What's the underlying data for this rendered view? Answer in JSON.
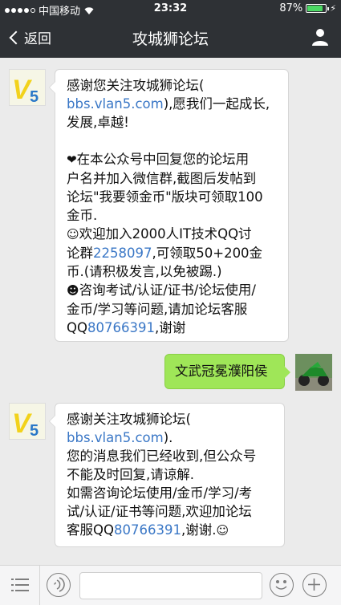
{
  "status_bar": {
    "carrier": "中国移动",
    "time": "23:32",
    "battery": "87%",
    "battery_level": 0.87
  },
  "nav": {
    "back_label": "返回",
    "title": "攻城狮论坛"
  },
  "messages": {
    "m1": {
      "l1": "感谢您关注攻城狮论坛(",
      "l2_link": "bbs.vlan5.com",
      "l2_text": "),愿我们一起成长,",
      "l3": "发展,卓越!",
      "l4": "在本公众号中回复您的论坛用",
      "l5": "户名并加入微信群,截图后发帖到",
      "l6": "论坛\"我要领金币\"版块可领取100",
      "l7": "金币.",
      "l8": "欢迎加入2000人IT技术QQ讨",
      "l9_text": "论群",
      "l9_link": "2258097",
      "l9_text2": ",可领取50+200金",
      "l10": "币.(请积极发言,以免被踢.)",
      "l11": "咨询考试/认证/证书/论坛使用/",
      "l12": "金币/学习等问题,请加论坛客服",
      "l13_text": "QQ",
      "l13_link": "80766391",
      "l13_text2": ",谢谢"
    },
    "m2": {
      "text": "文武冠冕濮阳侯"
    },
    "m3": {
      "l1": "感谢关注攻城狮论坛(",
      "l2_link": "bbs.vlan5.com",
      "l2_text": ").",
      "l3": "您的消息我们已经收到,但公众号",
      "l4": "不能及时回复,请谅解.",
      "l5": "如需咨询论坛使用/金币/学习/考",
      "l6": "试/认证/证书等问题,欢迎加论坛",
      "l7_text": "客服QQ",
      "l7_link": "80766391",
      "l7_text2": ",谢谢."
    }
  },
  "icons": {
    "heart": "heart-emoji",
    "smile": "smile-emoji",
    "wink": "wink-emoji"
  },
  "colors": {
    "nav_bg": "#2e3135",
    "chat_bg": "#ebebeb",
    "sent_bubble": "#9fe658",
    "link": "#3a77c6",
    "brand_yellow": "#f2d21b",
    "brand_blue": "#2a78c8"
  }
}
